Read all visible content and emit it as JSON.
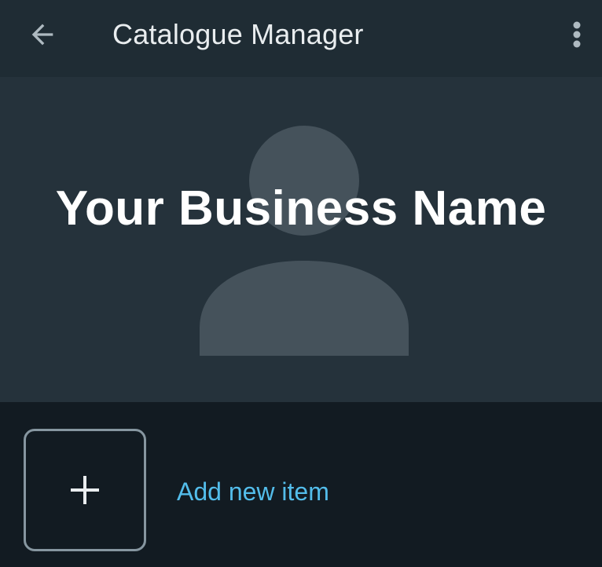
{
  "header": {
    "title": "Catalogue Manager",
    "back_icon": "arrow-left-icon",
    "menu_icon": "more-vertical-icon"
  },
  "cover": {
    "business_name": "Your Business Name",
    "placeholder_icon": "person-silhouette-icon"
  },
  "catalogue": {
    "add_item_label": "Add new item",
    "add_icon": "plus-icon"
  },
  "colors": {
    "header_bg": "#1f2c34",
    "cover_bg": "#25323b",
    "page_bg": "#121b22",
    "silhouette": "#45525b",
    "accent": "#53bdeb",
    "icon_gray": "#aebac1",
    "title_text": "#e9edef"
  }
}
